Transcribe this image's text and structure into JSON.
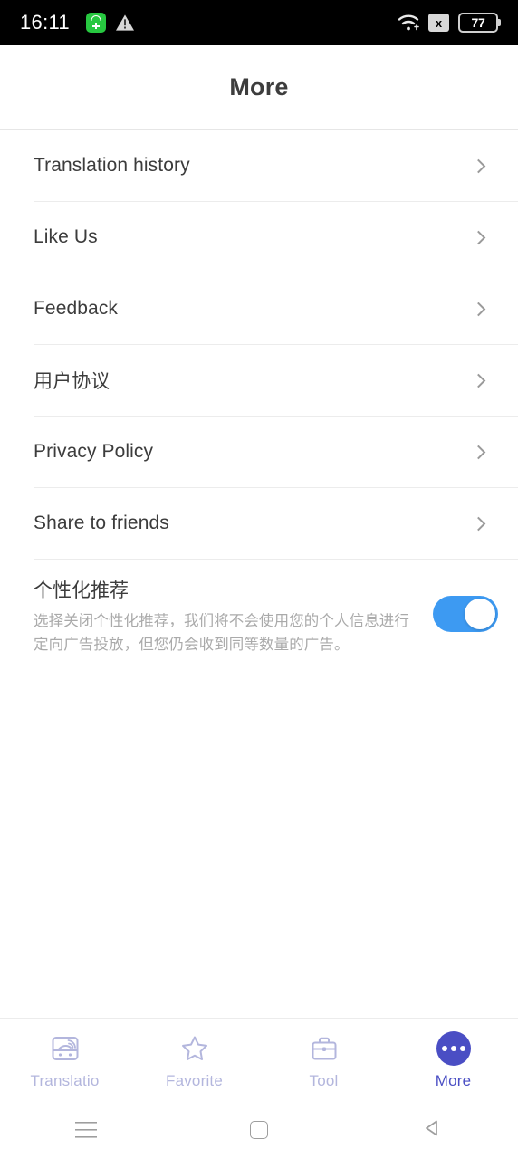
{
  "status_bar": {
    "time": "16:11",
    "left_icons": [
      {
        "name": "notification-app-icon",
        "glyph": "green-app-badge"
      },
      {
        "name": "warning-icon",
        "glyph": "triangle-exclamation"
      }
    ],
    "right_icons": [
      {
        "name": "wifi-icon",
        "glyph": "wifi"
      },
      {
        "name": "no-signal-icon",
        "label": "x"
      }
    ],
    "battery_percent": "77"
  },
  "header": {
    "title": "More"
  },
  "menu": {
    "items": [
      {
        "label": "Translation history",
        "name": "translation-history"
      },
      {
        "label": "Like Us",
        "name": "like-us"
      },
      {
        "label": "Feedback",
        "name": "feedback"
      },
      {
        "label": "用户协议",
        "name": "user-agreement"
      },
      {
        "label": "Privacy Policy",
        "name": "privacy-policy"
      },
      {
        "label": "Share to friends",
        "name": "share-to-friends"
      }
    ]
  },
  "personalized": {
    "title": "个性化推荐",
    "description": "选择关闭个性化推荐，我们将不会使用您的个人信息进行定向广告投放，但您仍会收到同等数量的广告。",
    "toggle_on": true,
    "toggle_color": "#3d9af2"
  },
  "tab_bar": {
    "active_color": "#4a4ec4",
    "inactive_color": "#b3b6dd",
    "tabs": [
      {
        "label": "Translatio",
        "name": "translation",
        "icon": "translate-card-icon",
        "active": false
      },
      {
        "label": "Favorite",
        "name": "favorite",
        "icon": "star-icon",
        "active": false
      },
      {
        "label": "Tool",
        "name": "tool",
        "icon": "briefcase-icon",
        "active": false
      },
      {
        "label": "More",
        "name": "more",
        "icon": "ellipsis-circle-icon",
        "active": true
      }
    ]
  },
  "android_nav": {
    "buttons": [
      {
        "name": "recents-button",
        "icon": "hamburger-icon"
      },
      {
        "name": "home-button",
        "icon": "square-icon"
      },
      {
        "name": "back-button",
        "icon": "triangle-left-icon"
      }
    ]
  }
}
